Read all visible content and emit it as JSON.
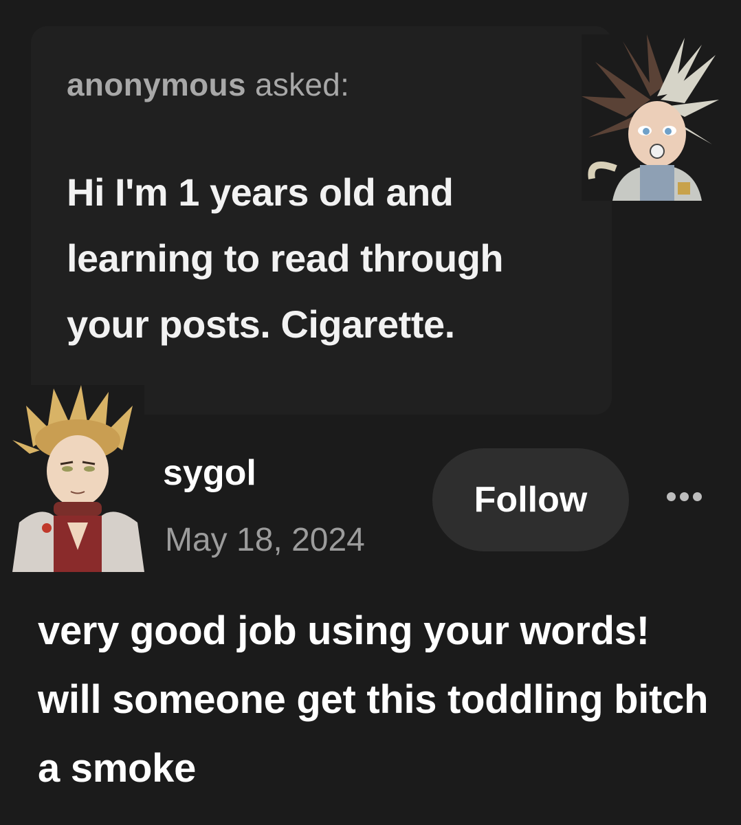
{
  "ask": {
    "asker_name": "anonymous",
    "asked_label": "asked:",
    "question_text": "Hi I'm 1 years old and learning to read through your posts. Cigarette."
  },
  "post": {
    "blog_name": "sygol",
    "date": "May 18, 2024",
    "follow_label": "Follow",
    "more_icon": "more-horizontal-icon",
    "answer_text": "very good job using your words! will someone get this toddling bitch a smoke"
  }
}
